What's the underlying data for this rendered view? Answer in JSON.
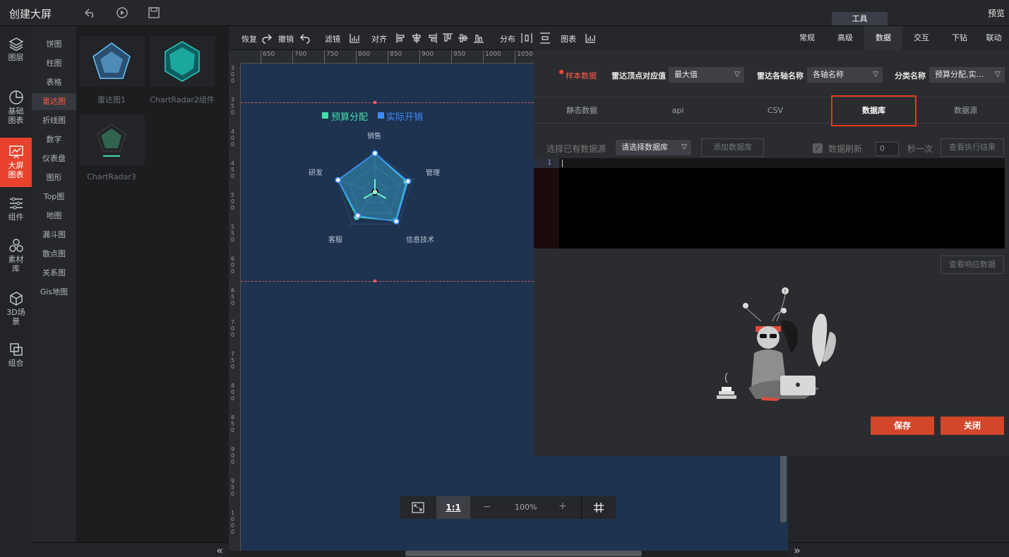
{
  "header": {
    "title": "创建大屏",
    "preview": "预览",
    "tools_tab": "工具"
  },
  "rail": [
    {
      "label": "图层",
      "icon": "layers-icon"
    },
    {
      "label": "基础图表",
      "icon": "pie-icon"
    },
    {
      "label": "大屏图表",
      "icon": "screen-chart-icon"
    },
    {
      "label": "组件",
      "icon": "sliders-icon"
    },
    {
      "label": "素材库",
      "icon": "material-icon"
    },
    {
      "label": "3D场景",
      "icon": "cube-icon"
    },
    {
      "label": "组合",
      "icon": "group-icon"
    }
  ],
  "categories": [
    "饼图",
    "柱图",
    "表格",
    "雷达图",
    "折线图",
    "数字",
    "仪表盘",
    "图形",
    "Top图",
    "地图",
    "漏斗图",
    "散点图",
    "关系图",
    "Gis地图"
  ],
  "active_category": "雷达图",
  "thumbnails": [
    {
      "label": "雷达图1"
    },
    {
      "label": "ChartRadar2组件"
    },
    {
      "label": "ChartRadar3"
    }
  ],
  "toolbar": {
    "redo": "恢复",
    "undo": "撤销",
    "filter": "滤镜",
    "align": "对齐",
    "distribute": "分布",
    "chart": "图表"
  },
  "hruler": [
    "650",
    "700",
    "750",
    "800",
    "850",
    "900",
    "950",
    "1000",
    "1050"
  ],
  "vruler": [
    "300",
    "350",
    "400",
    "450",
    "500",
    "550",
    "600",
    "650",
    "700",
    "750",
    "800",
    "850",
    "900",
    "950",
    "1000"
  ],
  "zoom": {
    "ratio_label": "1:1",
    "minus": "−",
    "value": "100%",
    "plus": "+"
  },
  "right_tabs": [
    "常规",
    "高级",
    "数据",
    "交互",
    "下钻",
    "联动"
  ],
  "active_right_tab": "数据",
  "settings": {
    "sample_label": "样本数据",
    "radar_max_label": "雷达顶点对应值",
    "radar_max_value": "最大值",
    "axis_name_label": "雷达各轴名称",
    "axis_name_value": "各轴名称",
    "category_label": "分类名称",
    "category_value": "预算分配,实..."
  },
  "source_tabs": [
    "静态数据",
    "api",
    "CSV",
    "数据库",
    "数据源"
  ],
  "active_source_tab": "数据库",
  "db": {
    "choose_label": "选择已有数据源",
    "choose_value": "请选择数据库",
    "add_btn": "添加数据库",
    "refresh_label": "数据刷新",
    "refresh_value": "0",
    "refresh_unit": "秒一次",
    "exec_btn": "查看执行结果",
    "line_no": "1",
    "resp_btn": "查看响应数据"
  },
  "actions": {
    "save": "保存",
    "close": "关闭"
  },
  "chart_data": {
    "type": "radar",
    "indicators": [
      "销售",
      "管理",
      "信息技术",
      "客服",
      "研发"
    ],
    "series": [
      {
        "name": "预算分配",
        "values": [
          0.98,
          0.84,
          0.9,
          0.78,
          0.98
        ]
      },
      {
        "name": "实际开销",
        "values": [
          0.98,
          0.88,
          0.92,
          0.74,
          0.98
        ]
      }
    ],
    "legend": "top",
    "colors": {
      "预算分配": "#3fe0a8",
      "实际开销": "#3a8cff"
    }
  }
}
